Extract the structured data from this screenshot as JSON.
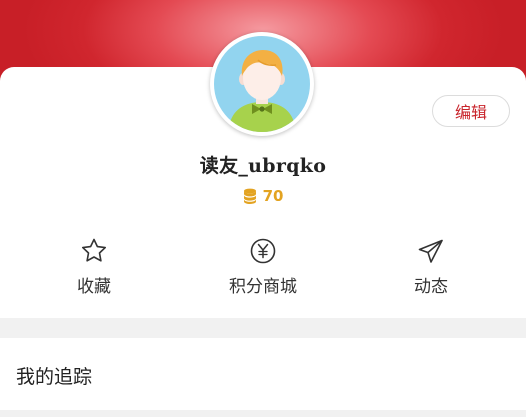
{
  "profile": {
    "username": "读友_ubrqko",
    "points": "70",
    "edit_label": "编辑"
  },
  "actions": [
    {
      "label": "收藏",
      "icon": "star-icon"
    },
    {
      "label": "积分商城",
      "icon": "yen-coin-icon"
    },
    {
      "label": "动态",
      "icon": "paper-plane-icon"
    }
  ],
  "tracking": {
    "title": "我的追踪"
  },
  "colors": {
    "header_red": "#d0262e",
    "accent_red": "#c9252c",
    "points_gold": "#e3a321"
  }
}
